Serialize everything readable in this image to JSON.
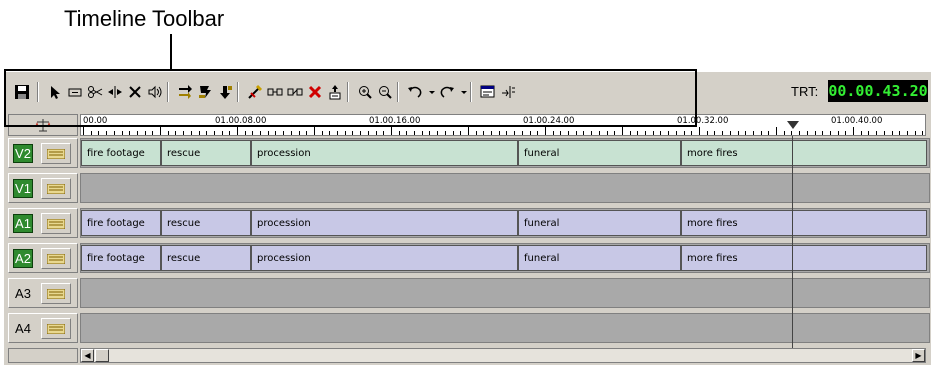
{
  "callout": {
    "label": "Timeline Toolbar"
  },
  "toolbar": {
    "trt_label": "TRT:",
    "trt_value": "00.00.43.20",
    "tools": [
      "save-icon",
      "pointer-icon",
      "trim-icon",
      "razor-icon",
      "split-icon",
      "delete-icon",
      "audio-icon",
      "insert-icon",
      "overwrite-icon",
      "lift-icon",
      "magic-icon",
      "link-icon",
      "unlink-icon",
      "remove-icon",
      "extract-icon",
      "zoom-in-icon",
      "zoom-out-icon",
      "undo-icon",
      "redo-icon",
      "properties-icon",
      "snap-icon"
    ]
  },
  "ruler": {
    "timecodes": [
      "00.00",
      "01.00.08.00",
      "01.00.16.00",
      "01.00.24.00",
      "01.00.32.00",
      "01.00.40.00"
    ]
  },
  "tracks": [
    {
      "name": "V2",
      "enabled": true,
      "type": "video",
      "clips": [
        "fire footage",
        "rescue",
        "procession",
        "funeral",
        "more fires"
      ]
    },
    {
      "name": "V1",
      "enabled": true,
      "type": "video",
      "clips": []
    },
    {
      "name": "A1",
      "enabled": true,
      "type": "audio",
      "clips": [
        "fire footage",
        "rescue",
        "procession",
        "funeral",
        "more fires"
      ]
    },
    {
      "name": "A2",
      "enabled": true,
      "type": "audio",
      "clips": [
        "fire footage",
        "rescue",
        "procession",
        "funeral",
        "more fires"
      ]
    },
    {
      "name": "A3",
      "enabled": false,
      "type": "audio",
      "clips": []
    },
    {
      "name": "A4",
      "enabled": false,
      "type": "audio",
      "clips": []
    }
  ],
  "colors": {
    "video_clip": "#c8e2d2",
    "audio_clip": "#c8c8e6",
    "track_on": "#2f8a2f",
    "trt_text": "#33ee33"
  }
}
